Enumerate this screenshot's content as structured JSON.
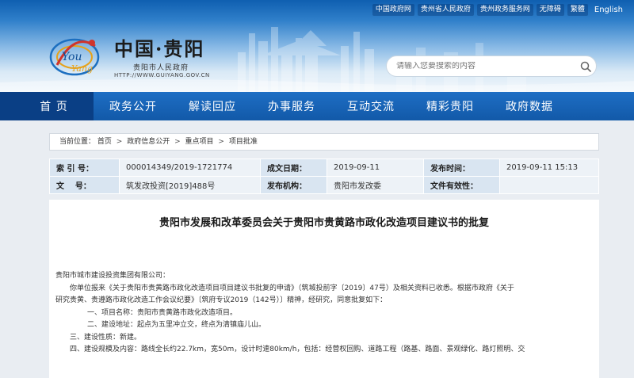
{
  "toplinks": [
    "中国政府网",
    "贵州省人民政府",
    "贵州政务服务网",
    "无障碍",
    "繁體",
    "English"
  ],
  "site": {
    "logo_text": "Youi Yang",
    "title": "中国·贵阳",
    "subtitle": "贵阳市人民政府",
    "url": "HTTP://WWW.GUIYANG.GOV.CN"
  },
  "search": {
    "placeholder": "请输入您要搜索的内容"
  },
  "nav": [
    "首 页",
    "政务公开",
    "解读回应",
    "办事服务",
    "互动交流",
    "精彩贵阳",
    "政府数据"
  ],
  "breadcrumb": {
    "prefix": "当前位置：",
    "items": [
      "首页",
      "政府信息公开",
      "重点项目",
      "项目批准"
    ],
    "separator": ">"
  },
  "meta": {
    "index_label": "索 引 号：",
    "index_value": "000014349/2019-1721774",
    "date_label": "成文日期：",
    "date_value": "2019-09-11",
    "publish_label": "发布时间：",
    "publish_value": "2019-09-11 15:13",
    "docno_label": "文    号：",
    "docno_value": "筑发改投资[2019]488号",
    "org_label": "发布机构：",
    "org_value": "贵阳市发改委",
    "validity_label": "文件有效性：",
    "validity_value": ""
  },
  "document": {
    "title": "贵阳市发展和改革委员会关于贵阳市贵黄路市政化改造项目建议书的批复",
    "lines": [
      "贵阳市城市建设投资集团有限公司：",
      "你单位报来《关于贵阳市贵黄路市政化改造项目项目建议书批复的申请》（筑城投前字〔2019〕47号）及相关资料已收悉。根据市政府《关于",
      "研究贵黄、贵遵路市政化改造工作会议纪要》〔筑府专议2019（142号）〕精神，经研究，同意批复如下：",
      "一、项目名称：贵阳市贵黄路市政化改造项目。",
      "二、建设地址：起点为五里冲立交，终点为清镇庙儿山。",
      "三、建设性质：新建。",
      "四、建设规模及内容：路线全长约22.7km，宽50m，设计时速80km/h，包括：经营权回购、道路工程（路基、路面、景观绿化、路灯照明、交"
    ]
  }
}
